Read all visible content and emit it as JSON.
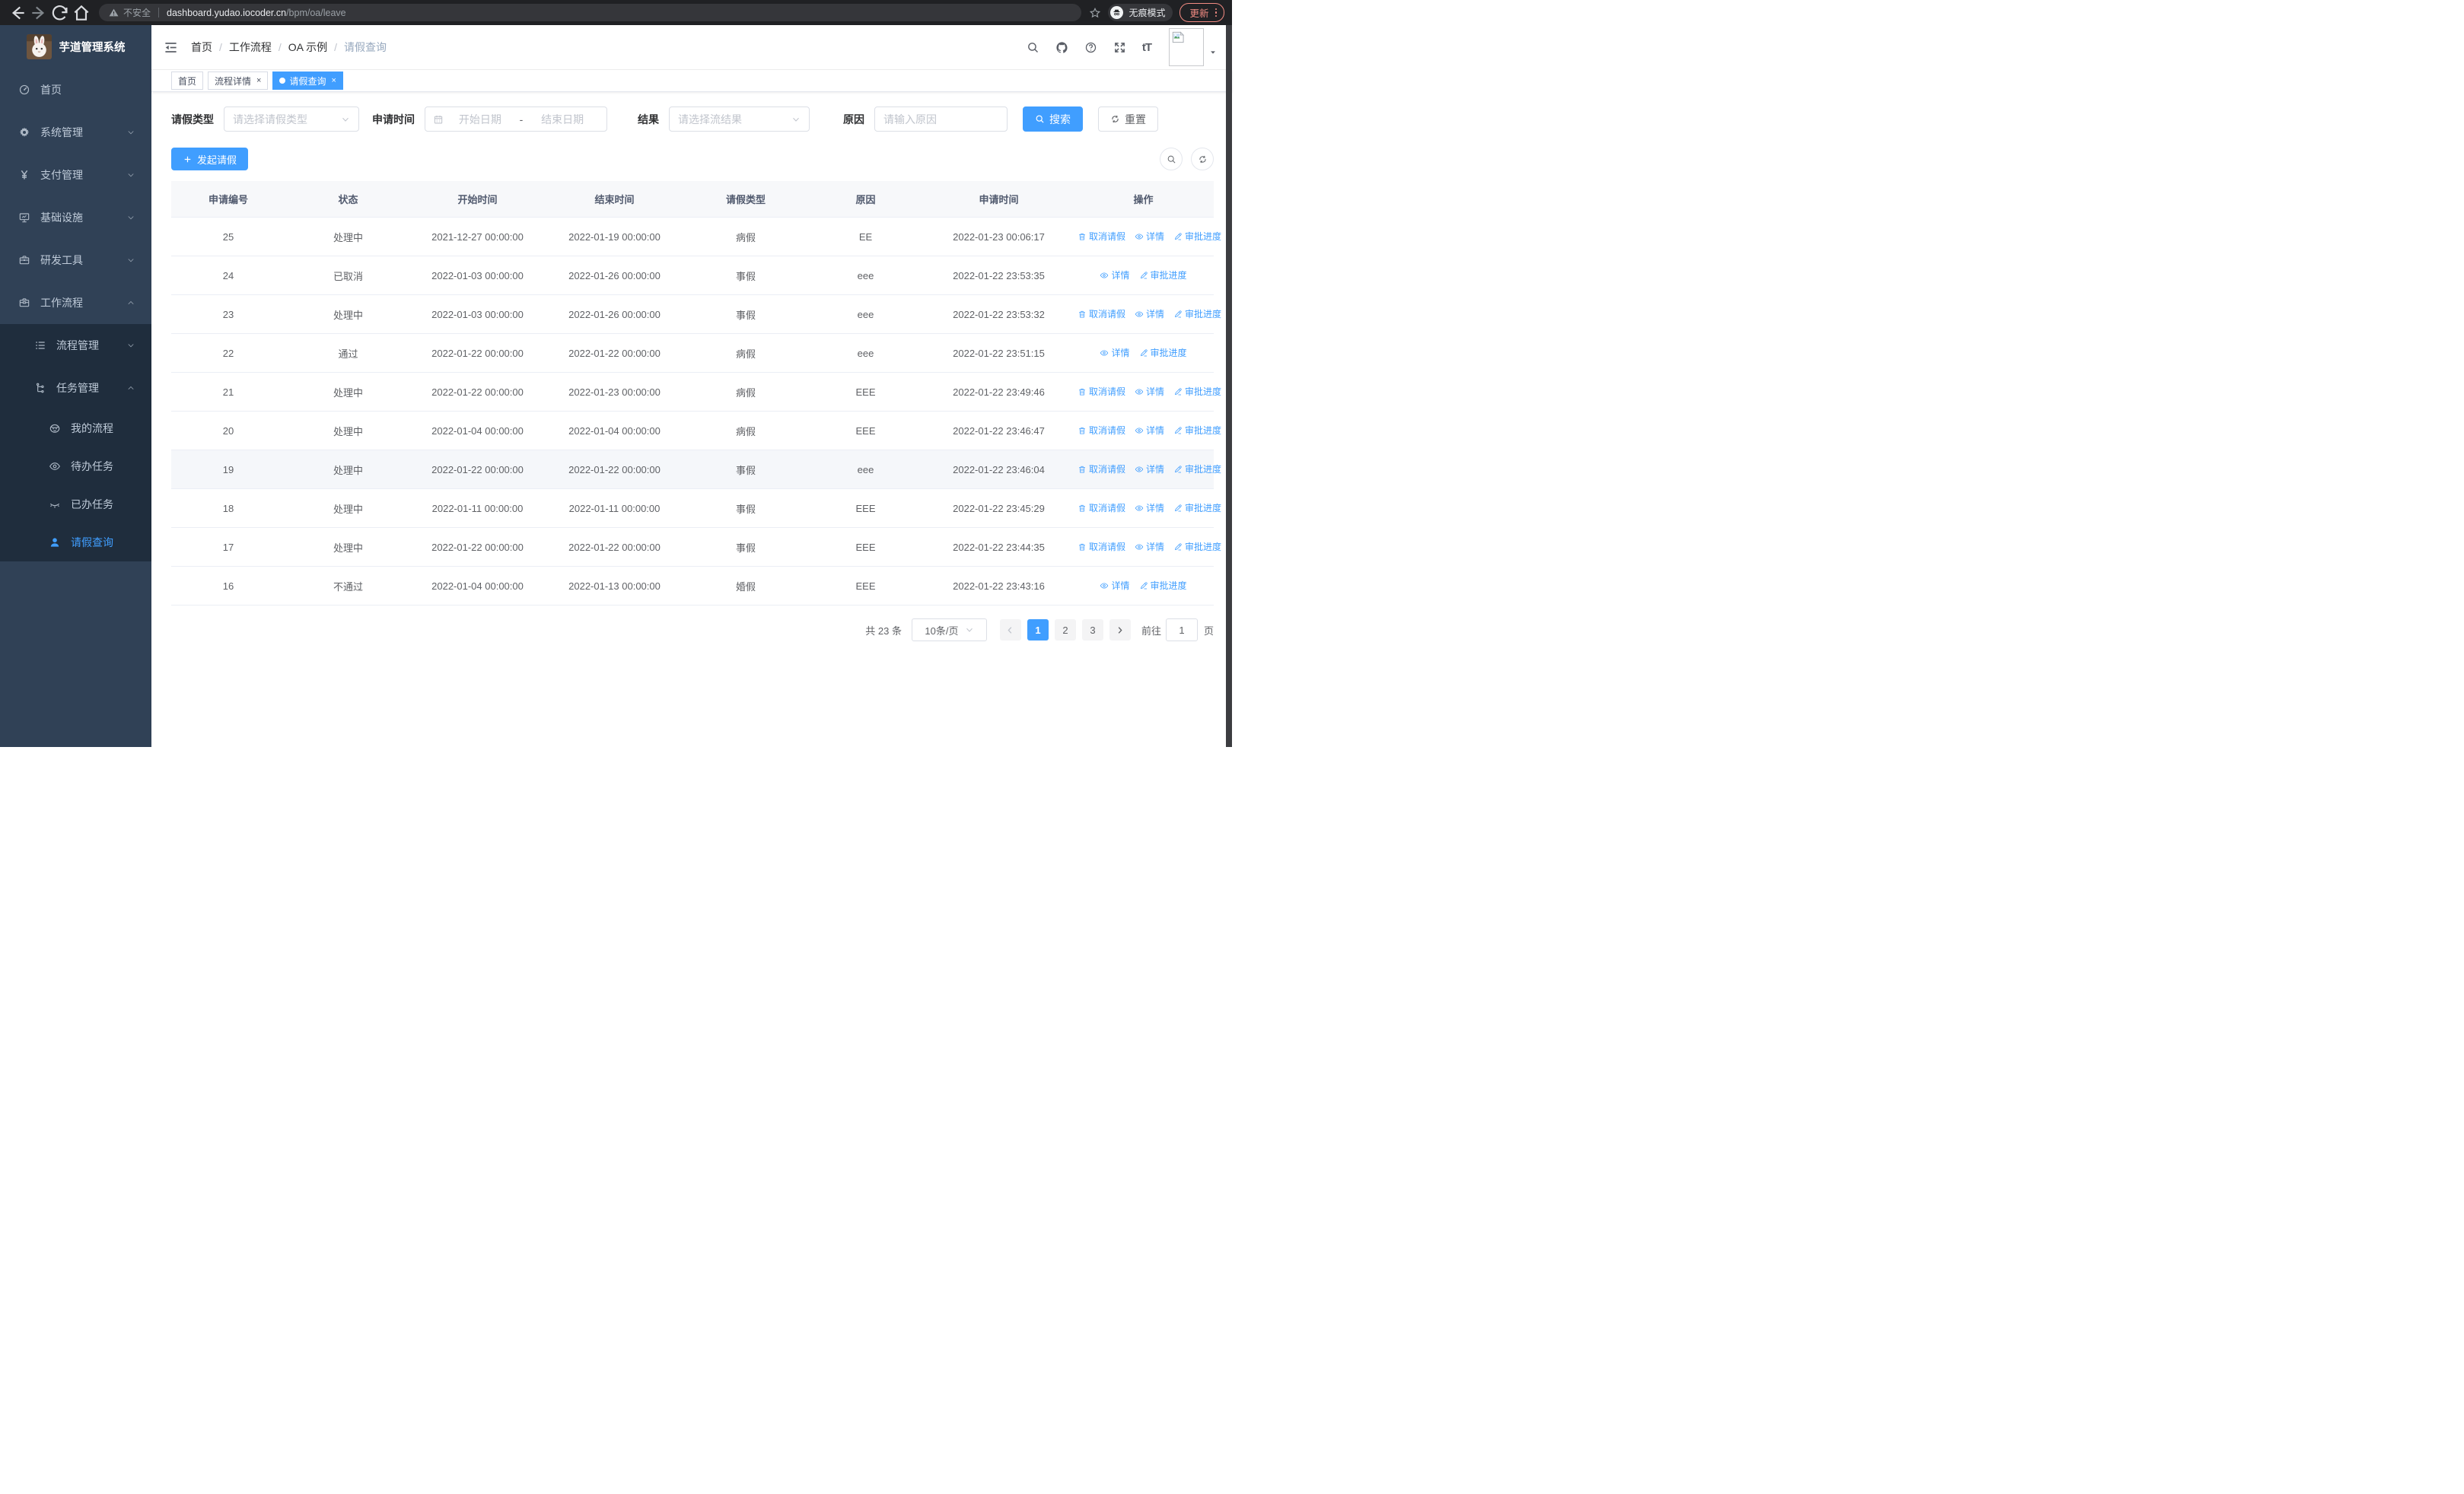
{
  "browser_chrome": {
    "security_label": "不安全",
    "url_host": "dashboard.yudao.iocoder.cn",
    "url_path": "/bpm/oa/leave",
    "incognito_label": "无痕模式",
    "update_label": "更新"
  },
  "sidebar": {
    "app_title": "芋道管理系统",
    "menu": [
      {
        "key": "home",
        "label": "首页",
        "icon": "dashboard-icon",
        "level": 1,
        "sub": false,
        "chevron": null,
        "active": false
      },
      {
        "key": "system",
        "label": "系统管理",
        "icon": "gear-icon",
        "level": 1,
        "sub": false,
        "chevron": "down",
        "active": false
      },
      {
        "key": "payment",
        "label": "支付管理",
        "icon": "yen-icon",
        "level": 1,
        "sub": false,
        "chevron": "down",
        "active": false
      },
      {
        "key": "infrastructure",
        "label": "基础设施",
        "icon": "monitor-icon",
        "level": 1,
        "sub": false,
        "chevron": "down",
        "active": false
      },
      {
        "key": "dev-tools",
        "label": "研发工具",
        "icon": "toolbox-icon",
        "level": 1,
        "sub": false,
        "chevron": "down",
        "active": false
      },
      {
        "key": "workflow",
        "label": "工作流程",
        "icon": "briefcase-icon",
        "level": 1,
        "sub": false,
        "chevron": "up",
        "active": false
      },
      {
        "key": "process-mgmt",
        "label": "流程管理",
        "icon": "list-tree-icon",
        "level": 2,
        "sub": true,
        "chevron": "down",
        "active": false
      },
      {
        "key": "task-mgmt",
        "label": "任务管理",
        "icon": "flow-tree-icon",
        "level": 2,
        "sub": true,
        "chevron": "up",
        "active": false
      },
      {
        "key": "my-process",
        "label": "我的流程",
        "icon": "face-icon",
        "level": 3,
        "sub": true,
        "chevron": null,
        "active": false
      },
      {
        "key": "todo-tasks",
        "label": "待办任务",
        "icon": "eye-icon",
        "level": 3,
        "sub": true,
        "chevron": null,
        "active": false
      },
      {
        "key": "done-tasks",
        "label": "已办任务",
        "icon": "eye-closed-icon",
        "level": 3,
        "sub": true,
        "chevron": null,
        "active": false
      },
      {
        "key": "leave-query",
        "label": "请假查询",
        "icon": "person-icon",
        "level": 3,
        "sub": true,
        "chevron": null,
        "active": true
      }
    ]
  },
  "navbar": {
    "breadcrumb": [
      {
        "key": "home",
        "label": "首页",
        "current": false
      },
      {
        "key": "workflow",
        "label": "工作流程",
        "current": false
      },
      {
        "key": "oa-demo",
        "label": "OA 示例",
        "current": false
      },
      {
        "key": "leave-query",
        "label": "请假查询",
        "current": true
      }
    ],
    "separator": "/"
  },
  "tags_bar": [
    {
      "key": "home",
      "label": "首页",
      "active": false,
      "closable": false
    },
    {
      "key": "process-detail",
      "label": "流程详情",
      "active": false,
      "closable": true
    },
    {
      "key": "leave-query",
      "label": "请假查询",
      "active": true,
      "closable": true
    }
  ],
  "filters": {
    "type_label": "请假类型",
    "type_placeholder": "请选择请假类型",
    "time_label": "申请时间",
    "time_start_placeholder": "开始日期",
    "time_separator": "-",
    "time_end_placeholder": "结束日期",
    "result_label": "结果",
    "result_placeholder": "请选择流结果",
    "reason_label": "原因",
    "reason_placeholder": "请输入原因",
    "search_label": "搜索",
    "reset_label": "重置"
  },
  "toolbar": {
    "create_label": "发起请假"
  },
  "table": {
    "columns": [
      "申请编号",
      "状态",
      "开始时间",
      "结束时间",
      "请假类型",
      "原因",
      "申请时间",
      "操作"
    ],
    "action_labels": {
      "cancel": "取消请假",
      "detail": "详情",
      "progress": "审批进度"
    },
    "rows": [
      {
        "id": "25",
        "status": "处理中",
        "start_time": "2021-12-27 00:00:00",
        "end_time": "2022-01-19 00:00:00",
        "leave_type": "病假",
        "reason": "EE",
        "apply_time": "2022-01-23 00:06:17",
        "can_cancel": true,
        "highlighted": false
      },
      {
        "id": "24",
        "status": "已取消",
        "start_time": "2022-01-03 00:00:00",
        "end_time": "2022-01-26 00:00:00",
        "leave_type": "事假",
        "reason": "eee",
        "apply_time": "2022-01-22 23:53:35",
        "can_cancel": false,
        "highlighted": false
      },
      {
        "id": "23",
        "status": "处理中",
        "start_time": "2022-01-03 00:00:00",
        "end_time": "2022-01-26 00:00:00",
        "leave_type": "事假",
        "reason": "eee",
        "apply_time": "2022-01-22 23:53:32",
        "can_cancel": true,
        "highlighted": false
      },
      {
        "id": "22",
        "status": "通过",
        "start_time": "2022-01-22 00:00:00",
        "end_time": "2022-01-22 00:00:00",
        "leave_type": "病假",
        "reason": "eee",
        "apply_time": "2022-01-22 23:51:15",
        "can_cancel": false,
        "highlighted": false
      },
      {
        "id": "21",
        "status": "处理中",
        "start_time": "2022-01-22 00:00:00",
        "end_time": "2022-01-23 00:00:00",
        "leave_type": "病假",
        "reason": "EEE",
        "apply_time": "2022-01-22 23:49:46",
        "can_cancel": true,
        "highlighted": false
      },
      {
        "id": "20",
        "status": "处理中",
        "start_time": "2022-01-04 00:00:00",
        "end_time": "2022-01-04 00:00:00",
        "leave_type": "病假",
        "reason": "EEE",
        "apply_time": "2022-01-22 23:46:47",
        "can_cancel": true,
        "highlighted": false
      },
      {
        "id": "19",
        "status": "处理中",
        "start_time": "2022-01-22 00:00:00",
        "end_time": "2022-01-22 00:00:00",
        "leave_type": "事假",
        "reason": "eee",
        "apply_time": "2022-01-22 23:46:04",
        "can_cancel": true,
        "highlighted": true
      },
      {
        "id": "18",
        "status": "处理中",
        "start_time": "2022-01-11 00:00:00",
        "end_time": "2022-01-11 00:00:00",
        "leave_type": "事假",
        "reason": "EEE",
        "apply_time": "2022-01-22 23:45:29",
        "can_cancel": true,
        "highlighted": false
      },
      {
        "id": "17",
        "status": "处理中",
        "start_time": "2022-01-22 00:00:00",
        "end_time": "2022-01-22 00:00:00",
        "leave_type": "事假",
        "reason": "EEE",
        "apply_time": "2022-01-22 23:44:35",
        "can_cancel": true,
        "highlighted": false
      },
      {
        "id": "16",
        "status": "不通过",
        "start_time": "2022-01-04 00:00:00",
        "end_time": "2022-01-13 00:00:00",
        "leave_type": "婚假",
        "reason": "EEE",
        "apply_time": "2022-01-22 23:43:16",
        "can_cancel": false,
        "highlighted": false
      }
    ]
  },
  "pagination": {
    "total_label": "共 23 条",
    "page_size_label": "10条/页",
    "pages": [
      "1",
      "2",
      "3"
    ],
    "current_page": "1",
    "goto_label": "前往",
    "goto_value": "1",
    "goto_unit_label": "页"
  },
  "colors": {
    "primary": "#409eff",
    "sidebar_bg": "#304156",
    "submenu_bg": "#1f2d3d",
    "update_accent": "#f28b82",
    "chrome_bg": "#202124"
  }
}
